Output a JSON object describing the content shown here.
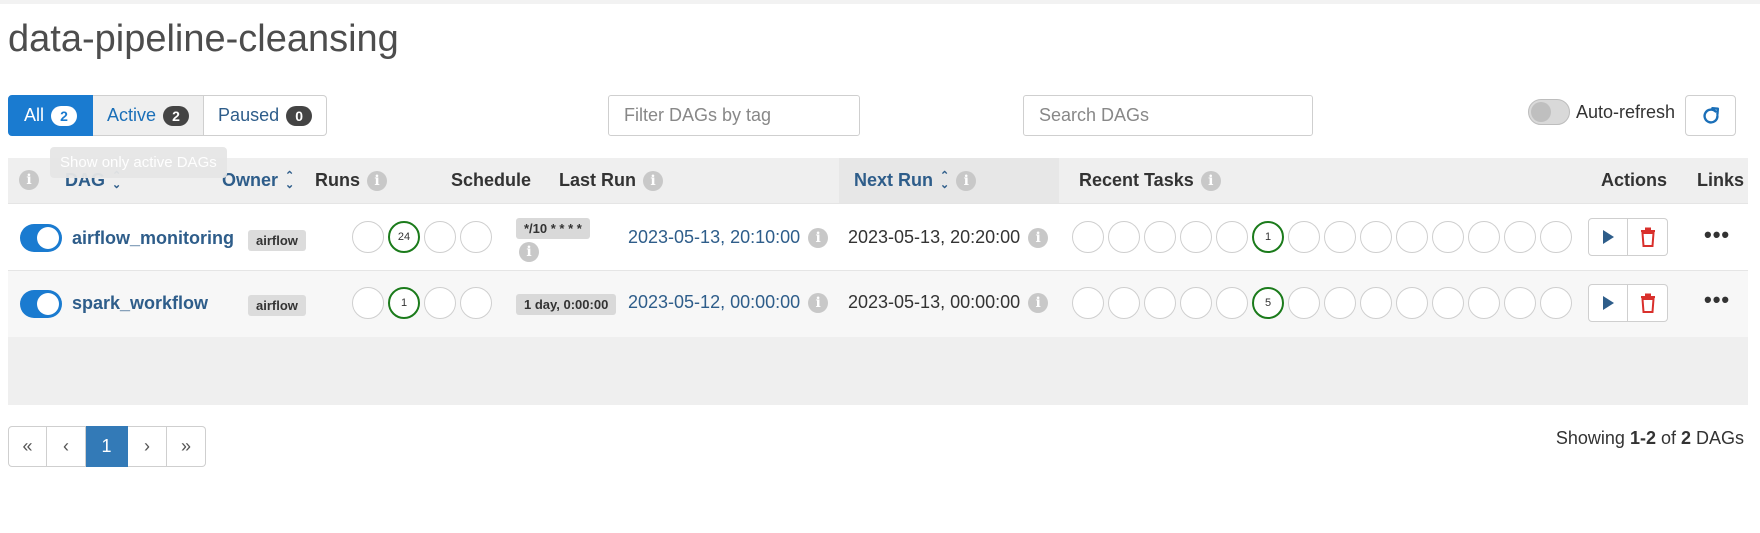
{
  "page": {
    "title": "data-pipeline-cleansing"
  },
  "filters": {
    "all_label": "All",
    "all_count": "2",
    "active_label": "Active",
    "active_count": "2",
    "paused_label": "Paused",
    "paused_count": "0",
    "tooltip": "Show only active DAGs"
  },
  "tag_filter": {
    "placeholder": "Filter DAGs by tag"
  },
  "search": {
    "placeholder": "Search DAGs"
  },
  "auto_refresh": {
    "label": "Auto-refresh",
    "enabled": false
  },
  "columns": {
    "dag": "DAG",
    "owner": "Owner",
    "runs": "Runs",
    "schedule": "Schedule",
    "last_run": "Last Run",
    "next_run": "Next Run",
    "recent_tasks": "Recent Tasks",
    "actions": "Actions",
    "links": "Links"
  },
  "dags": [
    {
      "name": "airflow_monitoring",
      "enabled": true,
      "owner": "airflow",
      "runs": [
        "",
        "24",
        "",
        ""
      ],
      "schedule_line1": "*/10 * * * *",
      "last_run": "2023-05-13, 20:10:00",
      "next_run": "2023-05-13, 20:20:00",
      "recent_tasks": [
        "",
        "",
        "",
        "",
        "",
        "1",
        "",
        "",
        "",
        "",
        "",
        "",
        "",
        ""
      ]
    },
    {
      "name": "spark_workflow",
      "enabled": true,
      "owner": "airflow",
      "runs": [
        "",
        "1",
        "",
        ""
      ],
      "schedule_line1": "1 day, 0:00:00",
      "last_run": "2023-05-12, 00:00:00",
      "next_run": "2023-05-13, 00:00:00",
      "recent_tasks": [
        "",
        "",
        "",
        "",
        "",
        "5",
        "",
        "",
        "",
        "",
        "",
        "",
        "",
        ""
      ]
    }
  ],
  "pagination": {
    "first": "«",
    "prev": "‹",
    "current": "1",
    "next": "›",
    "last": "»"
  },
  "showing": {
    "prefix": "Showing",
    "range": "1-2",
    "of": "of",
    "total": "2",
    "suffix": "DAGs"
  },
  "colors": {
    "accent": "#1a7bd0",
    "link": "#2e5d8a",
    "success": "#1b7b1b",
    "danger": "#d9302c"
  }
}
